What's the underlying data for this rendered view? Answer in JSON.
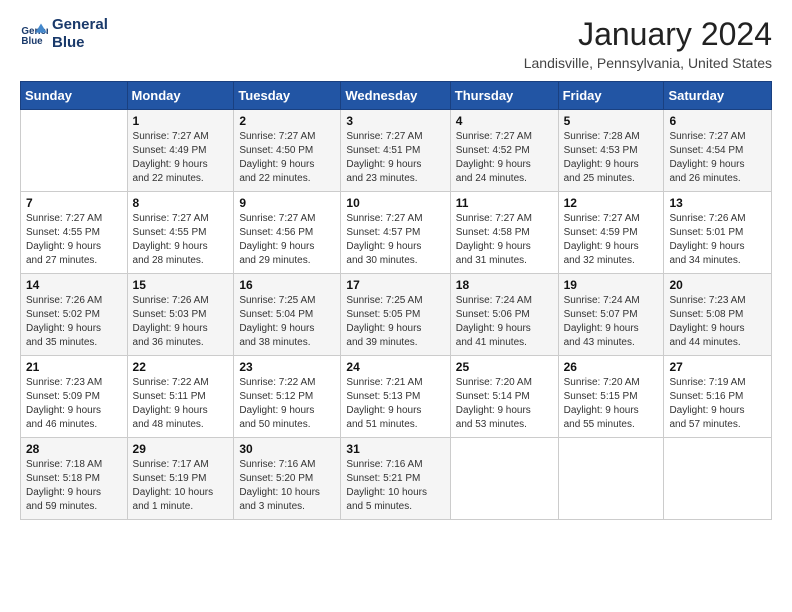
{
  "logo": {
    "line1": "General",
    "line2": "Blue"
  },
  "title": "January 2024",
  "location": "Landisville, Pennsylvania, United States",
  "days_of_week": [
    "Sunday",
    "Monday",
    "Tuesday",
    "Wednesday",
    "Thursday",
    "Friday",
    "Saturday"
  ],
  "weeks": [
    [
      {
        "day": "",
        "info": ""
      },
      {
        "day": "1",
        "info": "Sunrise: 7:27 AM\nSunset: 4:49 PM\nDaylight: 9 hours\nand 22 minutes."
      },
      {
        "day": "2",
        "info": "Sunrise: 7:27 AM\nSunset: 4:50 PM\nDaylight: 9 hours\nand 22 minutes."
      },
      {
        "day": "3",
        "info": "Sunrise: 7:27 AM\nSunset: 4:51 PM\nDaylight: 9 hours\nand 23 minutes."
      },
      {
        "day": "4",
        "info": "Sunrise: 7:27 AM\nSunset: 4:52 PM\nDaylight: 9 hours\nand 24 minutes."
      },
      {
        "day": "5",
        "info": "Sunrise: 7:28 AM\nSunset: 4:53 PM\nDaylight: 9 hours\nand 25 minutes."
      },
      {
        "day": "6",
        "info": "Sunrise: 7:27 AM\nSunset: 4:54 PM\nDaylight: 9 hours\nand 26 minutes."
      }
    ],
    [
      {
        "day": "7",
        "info": "Sunrise: 7:27 AM\nSunset: 4:55 PM\nDaylight: 9 hours\nand 27 minutes."
      },
      {
        "day": "8",
        "info": "Sunrise: 7:27 AM\nSunset: 4:55 PM\nDaylight: 9 hours\nand 28 minutes."
      },
      {
        "day": "9",
        "info": "Sunrise: 7:27 AM\nSunset: 4:56 PM\nDaylight: 9 hours\nand 29 minutes."
      },
      {
        "day": "10",
        "info": "Sunrise: 7:27 AM\nSunset: 4:57 PM\nDaylight: 9 hours\nand 30 minutes."
      },
      {
        "day": "11",
        "info": "Sunrise: 7:27 AM\nSunset: 4:58 PM\nDaylight: 9 hours\nand 31 minutes."
      },
      {
        "day": "12",
        "info": "Sunrise: 7:27 AM\nSunset: 4:59 PM\nDaylight: 9 hours\nand 32 minutes."
      },
      {
        "day": "13",
        "info": "Sunrise: 7:26 AM\nSunset: 5:01 PM\nDaylight: 9 hours\nand 34 minutes."
      }
    ],
    [
      {
        "day": "14",
        "info": "Sunrise: 7:26 AM\nSunset: 5:02 PM\nDaylight: 9 hours\nand 35 minutes."
      },
      {
        "day": "15",
        "info": "Sunrise: 7:26 AM\nSunset: 5:03 PM\nDaylight: 9 hours\nand 36 minutes."
      },
      {
        "day": "16",
        "info": "Sunrise: 7:25 AM\nSunset: 5:04 PM\nDaylight: 9 hours\nand 38 minutes."
      },
      {
        "day": "17",
        "info": "Sunrise: 7:25 AM\nSunset: 5:05 PM\nDaylight: 9 hours\nand 39 minutes."
      },
      {
        "day": "18",
        "info": "Sunrise: 7:24 AM\nSunset: 5:06 PM\nDaylight: 9 hours\nand 41 minutes."
      },
      {
        "day": "19",
        "info": "Sunrise: 7:24 AM\nSunset: 5:07 PM\nDaylight: 9 hours\nand 43 minutes."
      },
      {
        "day": "20",
        "info": "Sunrise: 7:23 AM\nSunset: 5:08 PM\nDaylight: 9 hours\nand 44 minutes."
      }
    ],
    [
      {
        "day": "21",
        "info": "Sunrise: 7:23 AM\nSunset: 5:09 PM\nDaylight: 9 hours\nand 46 minutes."
      },
      {
        "day": "22",
        "info": "Sunrise: 7:22 AM\nSunset: 5:11 PM\nDaylight: 9 hours\nand 48 minutes."
      },
      {
        "day": "23",
        "info": "Sunrise: 7:22 AM\nSunset: 5:12 PM\nDaylight: 9 hours\nand 50 minutes."
      },
      {
        "day": "24",
        "info": "Sunrise: 7:21 AM\nSunset: 5:13 PM\nDaylight: 9 hours\nand 51 minutes."
      },
      {
        "day": "25",
        "info": "Sunrise: 7:20 AM\nSunset: 5:14 PM\nDaylight: 9 hours\nand 53 minutes."
      },
      {
        "day": "26",
        "info": "Sunrise: 7:20 AM\nSunset: 5:15 PM\nDaylight: 9 hours\nand 55 minutes."
      },
      {
        "day": "27",
        "info": "Sunrise: 7:19 AM\nSunset: 5:16 PM\nDaylight: 9 hours\nand 57 minutes."
      }
    ],
    [
      {
        "day": "28",
        "info": "Sunrise: 7:18 AM\nSunset: 5:18 PM\nDaylight: 9 hours\nand 59 minutes."
      },
      {
        "day": "29",
        "info": "Sunrise: 7:17 AM\nSunset: 5:19 PM\nDaylight: 10 hours\nand 1 minute."
      },
      {
        "day": "30",
        "info": "Sunrise: 7:16 AM\nSunset: 5:20 PM\nDaylight: 10 hours\nand 3 minutes."
      },
      {
        "day": "31",
        "info": "Sunrise: 7:16 AM\nSunset: 5:21 PM\nDaylight: 10 hours\nand 5 minutes."
      },
      {
        "day": "",
        "info": ""
      },
      {
        "day": "",
        "info": ""
      },
      {
        "day": "",
        "info": ""
      }
    ]
  ]
}
